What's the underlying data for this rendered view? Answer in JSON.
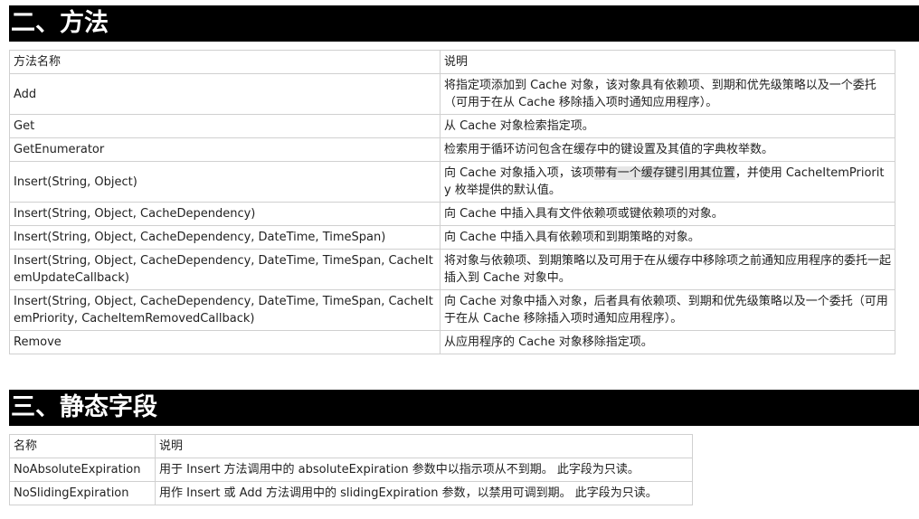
{
  "sections": [
    {
      "title": "二、方法",
      "headers": [
        "方法名称",
        "说明"
      ],
      "rows": [
        {
          "name": "Add",
          "desc": "将指定项添加到 Cache 对象，该对象具有依赖项、到期和优先级策略以及一个委托（可用于在从 Cache 移除插入项时通知应用程序）。"
        },
        {
          "name": "Get",
          "desc": "从 Cache 对象检索指定项。"
        },
        {
          "name": "GetEnumerator",
          "desc": "检索用于循环访问包含在缓存中的键设置及其值的字典枚举数。"
        },
        {
          "name": "Insert(String, Object)",
          "desc_parts": [
            "向 Cache 对象插入项，该项",
            "带有一个缓存键引用其位置",
            "，并使用 CacheItemPriority 枚举提供的默认值。"
          ]
        },
        {
          "name": "Insert(String, Object, CacheDependency)",
          "desc": "向 Cache 中插入具有文件依赖项或键依赖项的对象。"
        },
        {
          "name": "Insert(String, Object, CacheDependency, DateTime, TimeSpan)",
          "desc": "向 Cache 中插入具有依赖项和到期策略的对象。"
        },
        {
          "name": "Insert(String, Object, CacheDependency, DateTime, TimeSpan, CacheItemUpdateCallback)",
          "desc": "将对象与依赖项、到期策略以及可用于在从缓存中移除项之前通知应用程序的委托一起插入到 Cache 对象中。"
        },
        {
          "name": "Insert(String, Object, CacheDependency, DateTime, TimeSpan, CacheItemPriority, CacheItemRemovedCallback)",
          "desc": "向 Cache 对象中插入对象，后者具有依赖项、到期和优先级策略以及一个委托（可用于在从 Cache 移除插入项时通知应用程序）。"
        },
        {
          "name": "Remove",
          "desc": "从应用程序的 Cache 对象移除指定项。"
        }
      ]
    },
    {
      "title": "三、静态字段",
      "headers": [
        "名称",
        "说明"
      ],
      "rows": [
        {
          "name": "NoAbsoluteExpiration",
          "desc": "用于 Insert 方法调用中的 absoluteExpiration 参数中以指示项从不到期。 此字段为只读。"
        },
        {
          "name": "NoSlidingExpiration",
          "desc": "用作 Insert 或 Add 方法调用中的 slidingExpiration 参数，以禁用可调到期。 此字段为只读。"
        }
      ]
    }
  ]
}
